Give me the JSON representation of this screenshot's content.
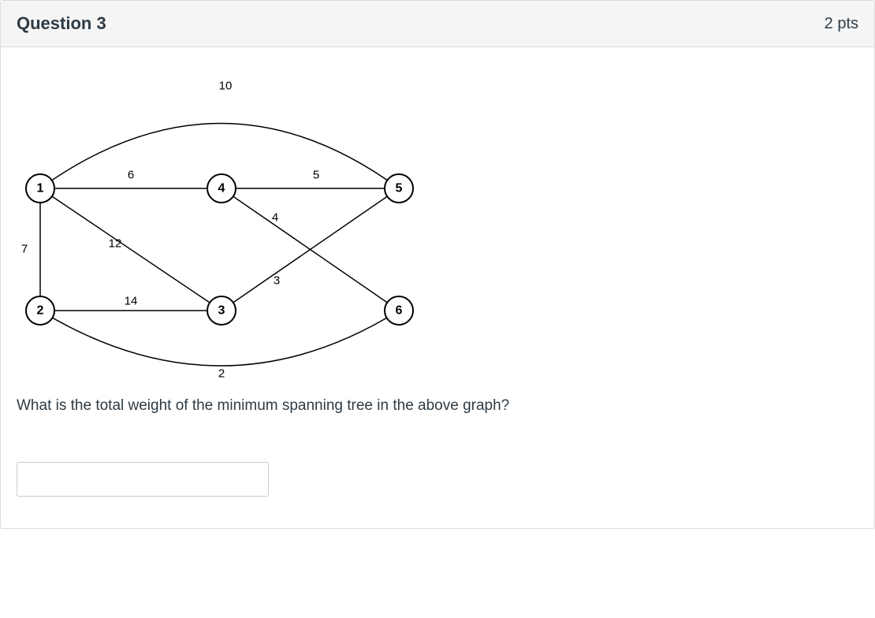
{
  "header": {
    "title": "Question 3",
    "points": "2 pts"
  },
  "question": {
    "text": "What is the total weight of the minimum spanning tree in the above  graph?",
    "answer_value": ""
  },
  "graph": {
    "nodes": {
      "n1": "1",
      "n2": "2",
      "n3": "3",
      "n4": "4",
      "n5": "5",
      "n6": "6"
    },
    "edges": {
      "e_1_4": "6",
      "e_1_5_arc": "10",
      "e_1_2": "7",
      "e_1_3": "12",
      "e_2_3": "14",
      "e_4_5": "5",
      "e_4_6": "4",
      "e_3_5": "3",
      "e_2_6_arc": "2"
    }
  }
}
